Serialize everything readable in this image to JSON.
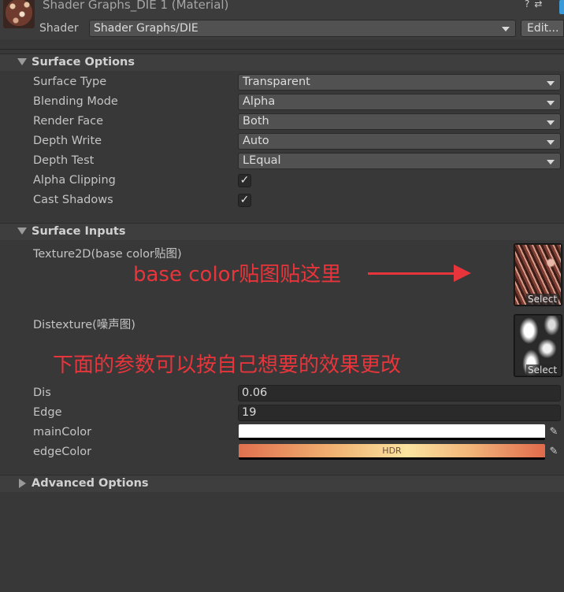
{
  "header": {
    "title": "Shader Graphs_DIE 1 (Material)",
    "help_icon": "?",
    "settings_icon": "⇄",
    "more_icon": "⋮",
    "shader_label": "Shader",
    "shader_value": "Shader Graphs/DIE",
    "edit_label": "Edit..."
  },
  "surface_options": {
    "title": "Surface Options",
    "rows": [
      {
        "label": "Surface Type",
        "value": "Transparent"
      },
      {
        "label": "Blending Mode",
        "value": "Alpha"
      },
      {
        "label": "Render Face",
        "value": "Both"
      },
      {
        "label": "Depth Write",
        "value": "Auto"
      },
      {
        "label": "Depth Test",
        "value": "LEqual"
      }
    ],
    "alpha_clipping": {
      "label": "Alpha Clipping",
      "checked": true,
      "mark": "✓"
    },
    "cast_shadows": {
      "label": "Cast Shadows",
      "checked": true,
      "mark": "✓"
    }
  },
  "surface_inputs": {
    "title": "Surface Inputs",
    "texture2d": {
      "label": "Texture2D(base color贴图)",
      "select_label": "Select"
    },
    "distexture": {
      "label": "Distexture(噪声图)",
      "select_label": "Select"
    },
    "dis": {
      "label": "Dis",
      "value": "0.06"
    },
    "edge": {
      "label": "Edge",
      "value": "19"
    },
    "main_color": {
      "label": "mainColor",
      "color": "#ffffff"
    },
    "edge_color": {
      "label": "edgeColor",
      "hdr_text": "HDR"
    },
    "picker_icon": "✎"
  },
  "annotations": {
    "base_color_note": "base color贴图贴这里",
    "params_note": "下面的参数可以按自己想要的效果更改",
    "color": "#e8353b"
  },
  "advanced_options": {
    "title": "Advanced Options"
  }
}
